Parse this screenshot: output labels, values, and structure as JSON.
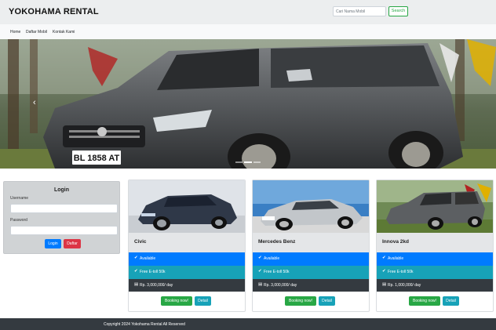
{
  "header": {
    "brand": "YOKOHAMA RENTAL",
    "search_placeholder": "Cari Nama Mobil",
    "search_label": "Search"
  },
  "nav": {
    "items": [
      "Home",
      "Daftar Mobil",
      "Kontak Kami"
    ]
  },
  "hero": {
    "plate": "BL 1858 AT",
    "prev_icon": "chevron-left-icon",
    "slides": 3,
    "active_slide": 1
  },
  "login": {
    "title": "Login",
    "username_label": "Username",
    "password_label": "Password",
    "login_label": "Login",
    "daftar_label": "Daftar"
  },
  "cars": [
    {
      "name": "Civic",
      "status": "Available",
      "etoll": "Free E-toll 50k",
      "price": "Rp. 3,000,000/ day",
      "booking_label": "Booking now!",
      "detail_label": "Detail"
    },
    {
      "name": "Mercedes Benz",
      "status": "Available",
      "etoll": "Free E-toll 50k",
      "price": "Rp. 3,000,000/ day",
      "booking_label": "Booking now!",
      "detail_label": "Detail"
    },
    {
      "name": "Innova 2kd",
      "status": "Available",
      "etoll": "Free E-toll 50k",
      "price": "Rp. 1,000,000/ day",
      "booking_label": "Booking now!",
      "detail_label": "Detail"
    }
  ],
  "icons": {
    "available": "check-icon",
    "etoll": "check-icon",
    "price": "money-icon"
  },
  "footer": {
    "copyright": "Copyright 2024 Yokohama Rental All Reserved"
  },
  "colors": {
    "primary": "#007bff",
    "info": "#17a2b8",
    "success": "#28a745",
    "danger": "#dc3545",
    "dark": "#343a40"
  }
}
